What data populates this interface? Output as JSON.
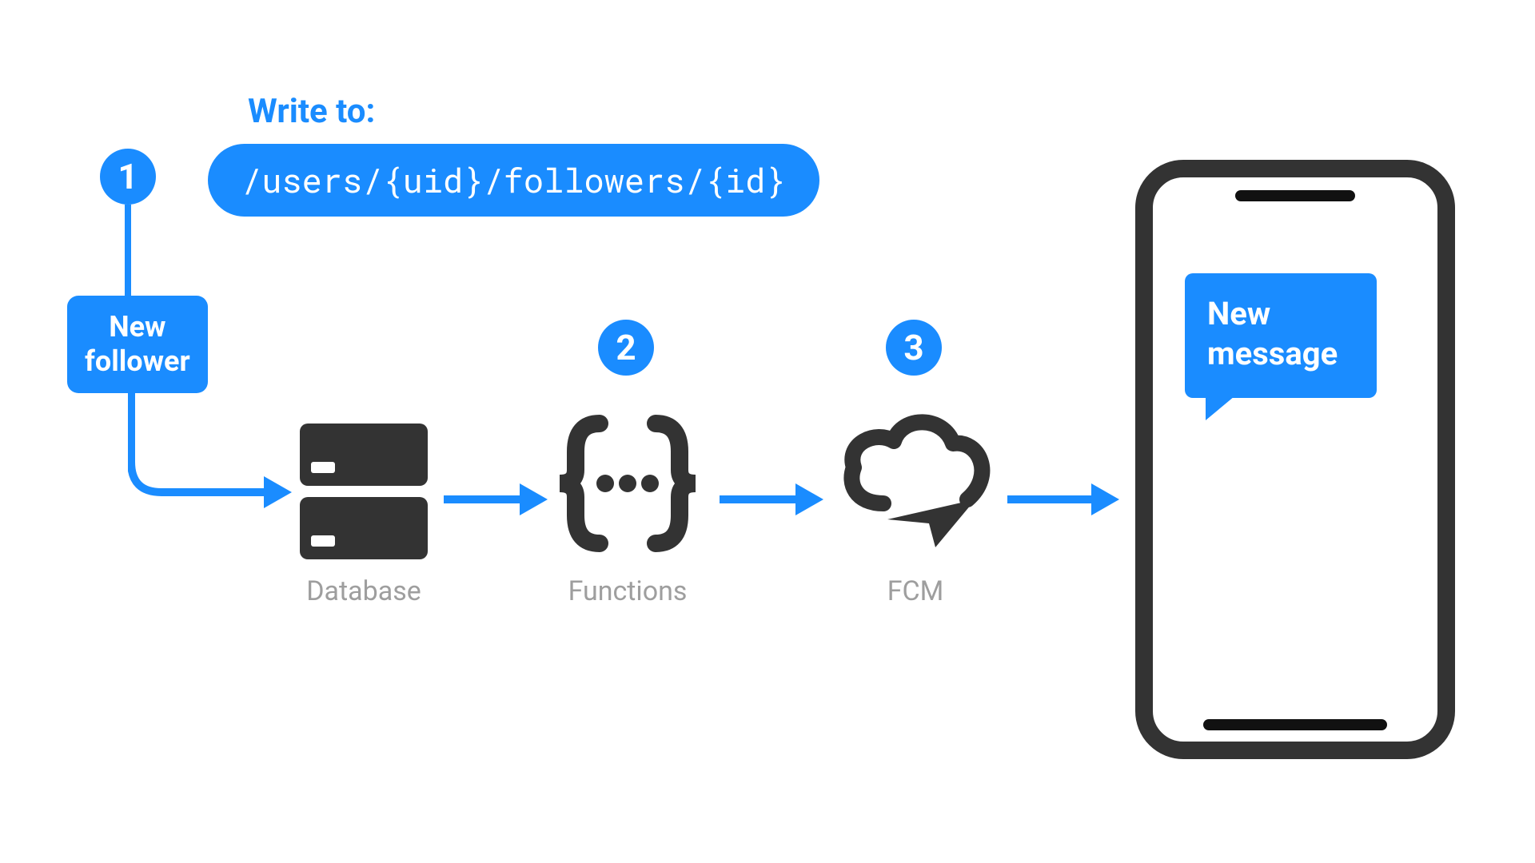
{
  "header": {
    "write_label": "Write to:",
    "path": "/users/{uid}/followers/{id}"
  },
  "steps": {
    "s1": "1",
    "s2": "2",
    "s3": "3"
  },
  "boxes": {
    "new_follower_line1": "New",
    "new_follower_line2": "follower"
  },
  "labels": {
    "database": "Database",
    "functions": "Functions",
    "fcm": "FCM"
  },
  "phone": {
    "bubble_line1": "New",
    "bubble_line2": "message"
  },
  "colors": {
    "accent": "#1a8cff",
    "icon": "#333333",
    "label": "#9e9e9e"
  }
}
